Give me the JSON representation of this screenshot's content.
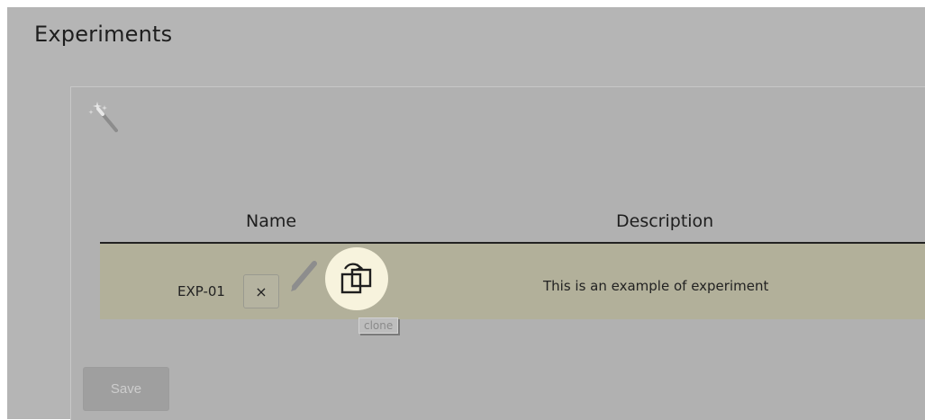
{
  "page": {
    "title": "Experiments"
  },
  "icons": {
    "toolbar": "magic-wand-icon",
    "edit": "pencil-icon",
    "delete": "close-icon",
    "clone": "clone-icon"
  },
  "table": {
    "columns": [
      "Name",
      "Description"
    ],
    "rows": [
      {
        "name": "EXP-01",
        "delete_label": "×",
        "description": "This is an example of experiment"
      }
    ]
  },
  "tooltip": {
    "text": "clone"
  },
  "actions": {
    "save_label": "Save"
  },
  "colors": {
    "row_highlight": "#b2b09a",
    "clone_highlight": "#f7f3dd",
    "background": "#b5b5b5"
  }
}
